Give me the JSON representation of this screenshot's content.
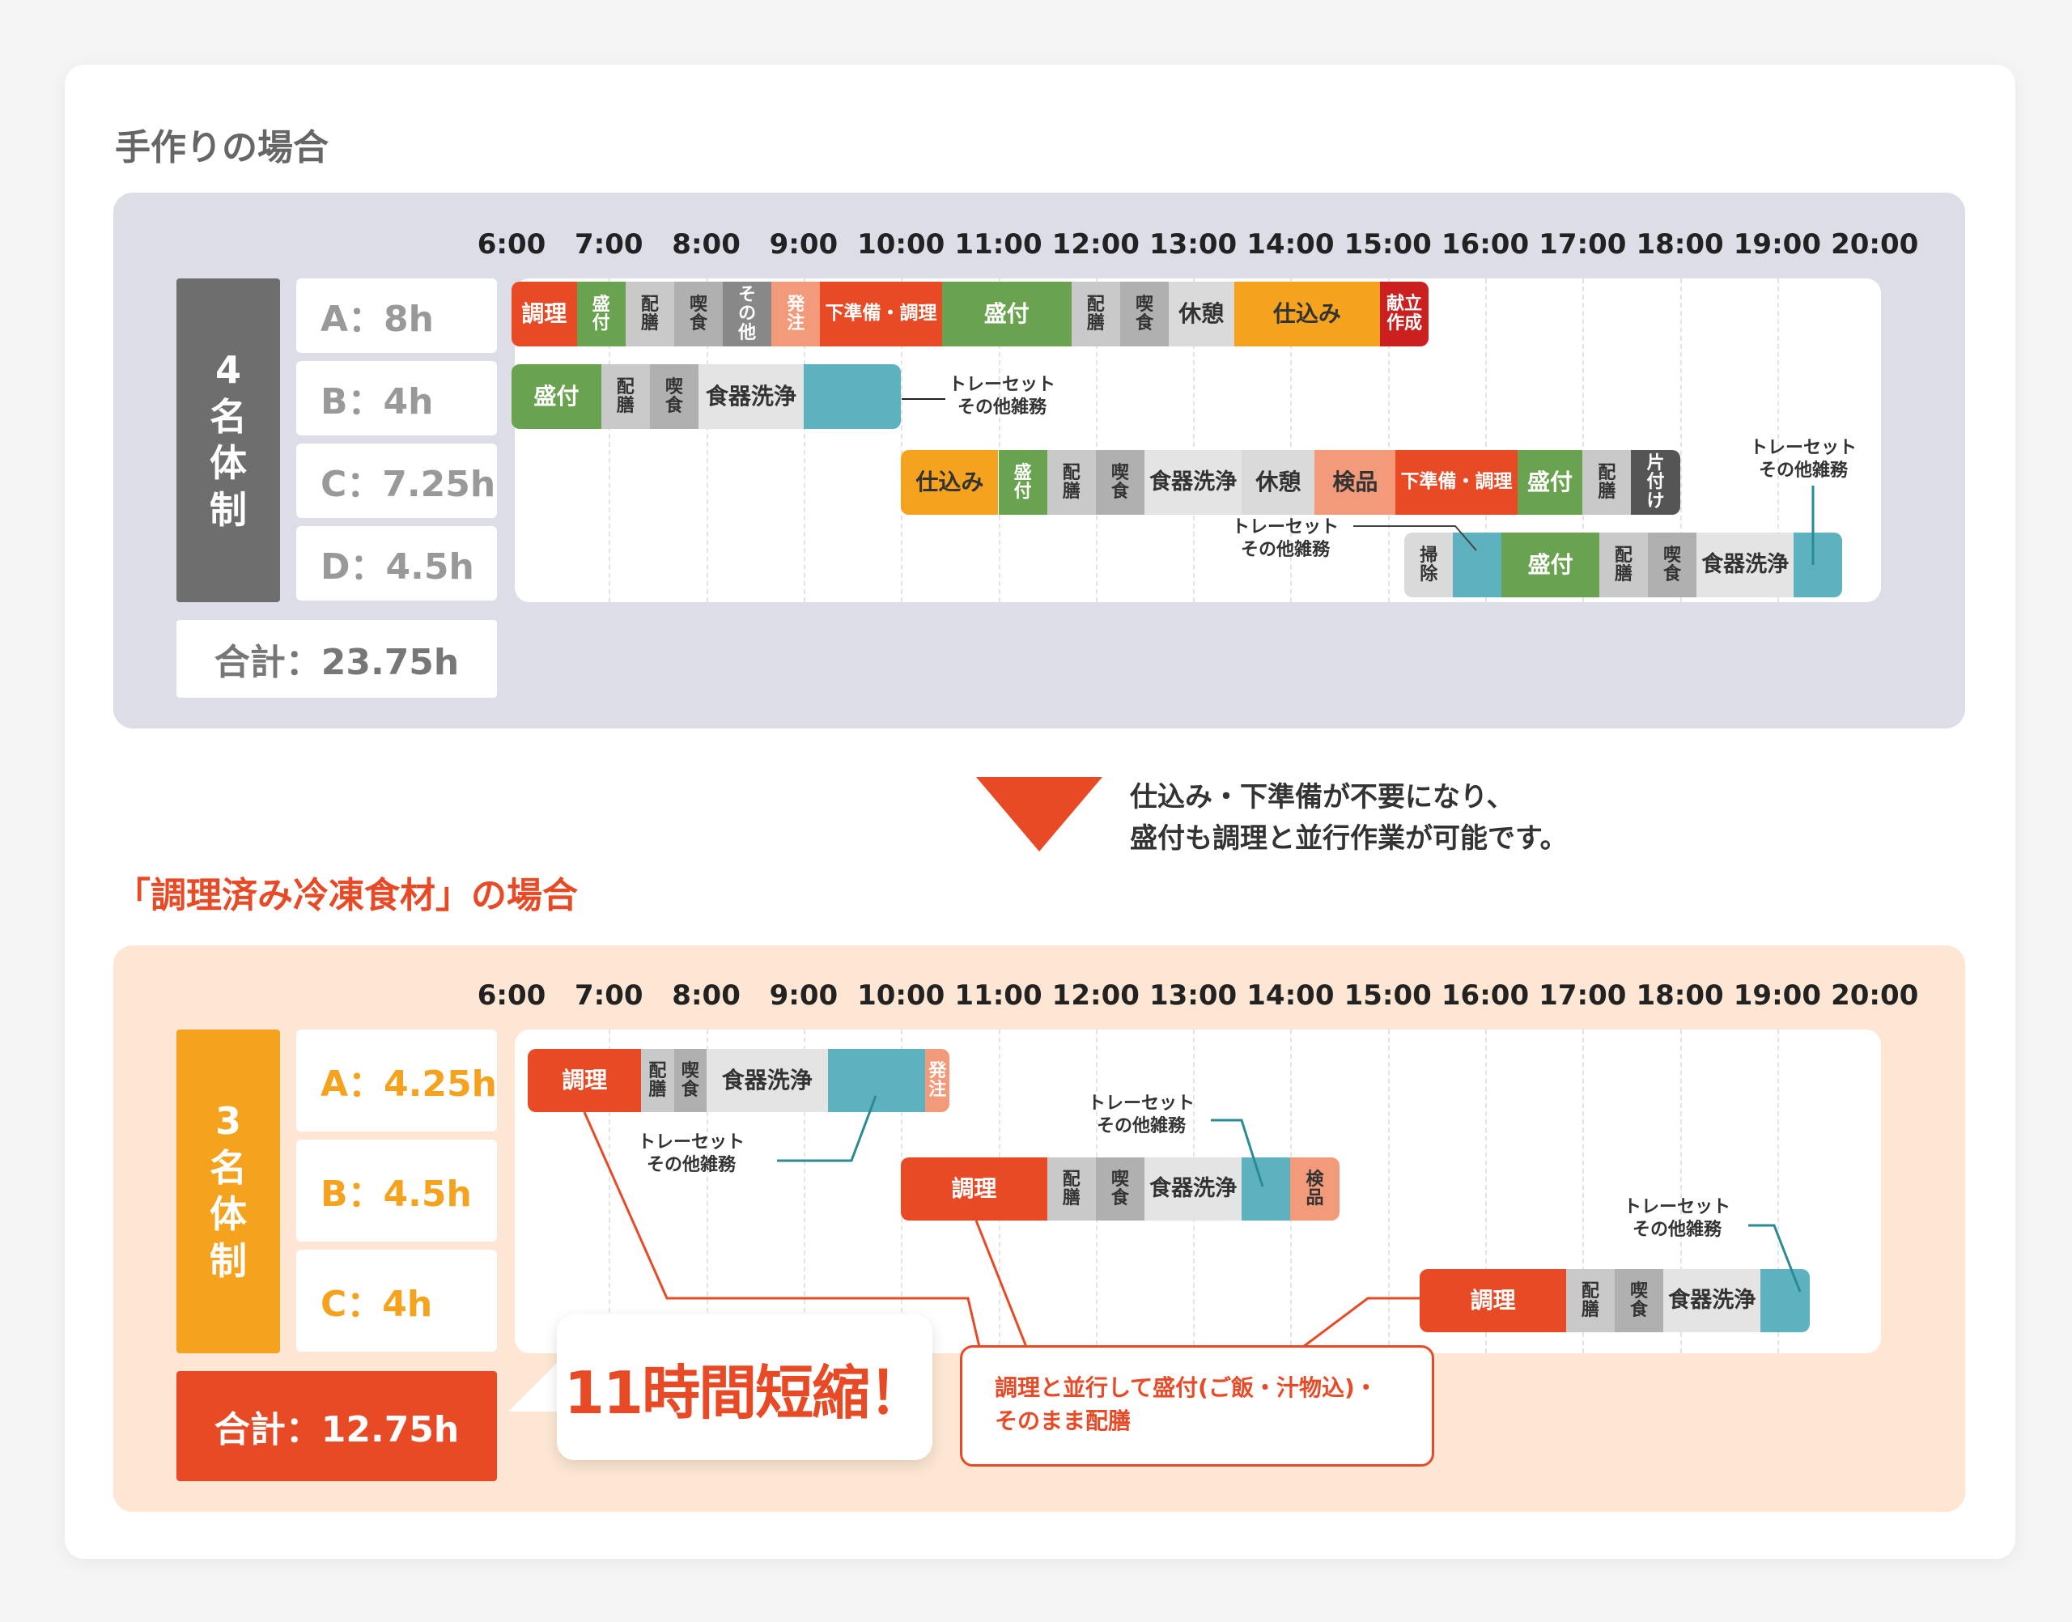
{
  "section1": {
    "title": "手作りの場合",
    "hours": [
      "6:00",
      "7:00",
      "8:00",
      "9:00",
      "10:00",
      "11:00",
      "12:00",
      "13:00",
      "14:00",
      "15:00",
      "16:00",
      "17:00",
      "18:00",
      "19:00",
      "20:00"
    ],
    "system": "4名体制",
    "workers": [
      {
        "label": "A：8h"
      },
      {
        "label": "B：4h"
      },
      {
        "label": "C：7.25h"
      },
      {
        "label": "D：4.5h"
      }
    ],
    "total": "合計：23.75h",
    "rows": [
      [
        {
          "label": "調理",
          "start": 6.0,
          "end": 6.67,
          "color": "#e84a26"
        },
        {
          "label": "盛付",
          "start": 6.67,
          "end": 7.17,
          "color": "#6aa34f",
          "vertical": true
        },
        {
          "label": "配膳",
          "start": 7.17,
          "end": 7.67,
          "color": "#c9c9c9",
          "dark": true,
          "vertical": true
        },
        {
          "label": "喫食",
          "start": 7.67,
          "end": 8.17,
          "color": "#b0b0b0",
          "dark": true,
          "vertical": true
        },
        {
          "label": "その他",
          "start": 8.17,
          "end": 8.67,
          "color": "#888888",
          "vertical": true
        },
        {
          "label": "発注",
          "start": 8.67,
          "end": 9.17,
          "color": "#f39a7a",
          "vertical": true
        },
        {
          "label": "下準備・調理",
          "start": 9.17,
          "end": 10.42,
          "color": "#e84a26"
        },
        {
          "label": "盛付",
          "start": 10.42,
          "end": 11.75,
          "color": "#6aa34f"
        },
        {
          "label": "配膳",
          "start": 11.75,
          "end": 12.25,
          "color": "#c9c9c9",
          "dark": true,
          "vertical": true
        },
        {
          "label": "喫食",
          "start": 12.25,
          "end": 12.75,
          "color": "#b0b0b0",
          "dark": true,
          "vertical": true
        },
        {
          "label": "休憩",
          "start": 12.75,
          "end": 13.42,
          "color": "#dadada",
          "dark": true
        },
        {
          "label": "仕込み",
          "start": 13.42,
          "end": 14.92,
          "color": "#f5a31e",
          "dark": true
        },
        {
          "label": "献立作成",
          "start": 14.92,
          "end": 15.42,
          "color": "#cc1f1f",
          "vertical": false,
          "twoLine": true
        }
      ],
      [
        {
          "label": "盛付",
          "start": 6.0,
          "end": 6.92,
          "color": "#6aa34f"
        },
        {
          "label": "配膳",
          "start": 6.92,
          "end": 7.42,
          "color": "#c9c9c9",
          "dark": true,
          "vertical": true
        },
        {
          "label": "喫食",
          "start": 7.42,
          "end": 7.92,
          "color": "#b0b0b0",
          "dark": true,
          "vertical": true
        },
        {
          "label": "食器洗浄",
          "start": 7.92,
          "end": 9.0,
          "color": "#e4e4e4",
          "dark": true
        },
        {
          "label": "",
          "start": 9.0,
          "end": 10.0,
          "color": "#5eb1bf"
        }
      ],
      [
        {
          "label": "仕込み",
          "start": 10.0,
          "end": 11.0,
          "color": "#f5a31e",
          "dark": true
        },
        {
          "label": "盛付",
          "start": 11.0,
          "end": 11.5,
          "color": "#6aa34f",
          "vertical": true
        },
        {
          "label": "配膳",
          "start": 11.5,
          "end": 12.0,
          "color": "#c9c9c9",
          "dark": true,
          "vertical": true
        },
        {
          "label": "喫食",
          "start": 12.0,
          "end": 12.5,
          "color": "#b0b0b0",
          "dark": true,
          "vertical": true
        },
        {
          "label": "食器洗浄",
          "start": 12.5,
          "end": 13.5,
          "color": "#e4e4e4",
          "dark": true
        },
        {
          "label": "休憩",
          "start": 13.5,
          "end": 14.25,
          "color": "#dadada",
          "dark": true
        },
        {
          "label": "検品",
          "start": 14.25,
          "end": 15.08,
          "color": "#f39a7a",
          "dark": true
        },
        {
          "label": "下準備・調理",
          "start": 15.08,
          "end": 16.33,
          "color": "#e84a26"
        },
        {
          "label": "盛付",
          "start": 16.33,
          "end": 17.0,
          "color": "#6aa34f"
        },
        {
          "label": "配膳",
          "start": 17.0,
          "end": 17.5,
          "color": "#c9c9c9",
          "dark": true,
          "vertical": true
        },
        {
          "label": "片付け",
          "start": 17.5,
          "end": 18.0,
          "color": "#555555",
          "vertical": true
        }
      ],
      [
        {
          "label": "掃除",
          "start": 15.17,
          "end": 15.67,
          "color": "#dadada",
          "dark": true,
          "vertical": true
        },
        {
          "label": "",
          "start": 15.67,
          "end": 16.17,
          "color": "#5eb1bf"
        },
        {
          "label": "盛付",
          "start": 16.17,
          "end": 17.17,
          "color": "#6aa34f"
        },
        {
          "label": "配膳",
          "start": 17.17,
          "end": 17.67,
          "color": "#c9c9c9",
          "dark": true,
          "vertical": true
        },
        {
          "label": "喫食",
          "start": 17.67,
          "end": 18.17,
          "color": "#b0b0b0",
          "dark": true,
          "vertical": true
        },
        {
          "label": "食器洗浄",
          "start": 18.17,
          "end": 19.17,
          "color": "#e4e4e4",
          "dark": true
        },
        {
          "label": "",
          "start": 19.17,
          "end": 19.67,
          "color": "#5eb1bf"
        }
      ]
    ],
    "notes": [
      "トレーセット\nその他雑務",
      "トレーセット\nその他雑務",
      "トレーセット\nその他雑務"
    ]
  },
  "transition": {
    "line1": "仕込み・下準備が不要になり、",
    "line2": "盛付も調理と並行作業が可能です。"
  },
  "section2": {
    "title": "「調理済み冷凍食材」の場合",
    "hours": [
      "6:00",
      "7:00",
      "8:00",
      "9:00",
      "10:00",
      "11:00",
      "12:00",
      "13:00",
      "14:00",
      "15:00",
      "16:00",
      "17:00",
      "18:00",
      "19:00",
      "20:00"
    ],
    "system": "3名体制",
    "workers": [
      {
        "label": "A：4.25h"
      },
      {
        "label": "B：4.5h"
      },
      {
        "label": "C：4h"
      }
    ],
    "total": "合計：12.75h",
    "rows": [
      [
        {
          "label": "調理",
          "start": 6.17,
          "end": 7.33,
          "color": "#e84a26"
        },
        {
          "label": "配膳",
          "start": 7.33,
          "end": 7.67,
          "color": "#c9c9c9",
          "dark": true,
          "vertical": true
        },
        {
          "label": "喫食",
          "start": 7.67,
          "end": 8.0,
          "color": "#b0b0b0",
          "dark": true,
          "vertical": true
        },
        {
          "label": "食器洗浄",
          "start": 8.0,
          "end": 9.25,
          "color": "#e4e4e4",
          "dark": true
        },
        {
          "label": "",
          "start": 9.25,
          "end": 10.25,
          "color": "#5eb1bf"
        },
        {
          "label": "発注",
          "start": 10.25,
          "end": 10.5,
          "color": "#f39a7a",
          "vertical": true
        }
      ],
      [
        {
          "label": "調理",
          "start": 10.0,
          "end": 11.5,
          "color": "#e84a26"
        },
        {
          "label": "配膳",
          "start": 11.5,
          "end": 12.0,
          "color": "#c9c9c9",
          "dark": true,
          "vertical": true
        },
        {
          "label": "喫食",
          "start": 12.0,
          "end": 12.5,
          "color": "#b0b0b0",
          "dark": true,
          "vertical": true
        },
        {
          "label": "食器洗浄",
          "start": 12.5,
          "end": 13.5,
          "color": "#e4e4e4",
          "dark": true
        },
        {
          "label": "",
          "start": 13.5,
          "end": 14.0,
          "color": "#5eb1bf"
        },
        {
          "label": "検品",
          "start": 14.0,
          "end": 14.5,
          "color": "#f39a7a",
          "dark": true,
          "vertical": true
        }
      ],
      [
        {
          "label": "調理",
          "start": 15.33,
          "end": 16.83,
          "color": "#e84a26"
        },
        {
          "label": "配膳",
          "start": 16.83,
          "end": 17.33,
          "color": "#c9c9c9",
          "dark": true,
          "vertical": true
        },
        {
          "label": "喫食",
          "start": 17.33,
          "end": 17.83,
          "color": "#b0b0b0",
          "dark": true,
          "vertical": true
        },
        {
          "label": "食器洗浄",
          "start": 17.83,
          "end": 18.83,
          "color": "#e4e4e4",
          "dark": true
        },
        {
          "label": "",
          "start": 18.83,
          "end": 19.33,
          "color": "#5eb1bf"
        }
      ]
    ],
    "notes": [
      "トレーセット\nその他雑務",
      "トレーセット\nその他雑務",
      "トレーセット\nその他雑務"
    ],
    "savings": "11時間短縮！",
    "callout": "調理と並行して盛付(ご飯・汁物込)・\nそのまま配膳"
  }
}
